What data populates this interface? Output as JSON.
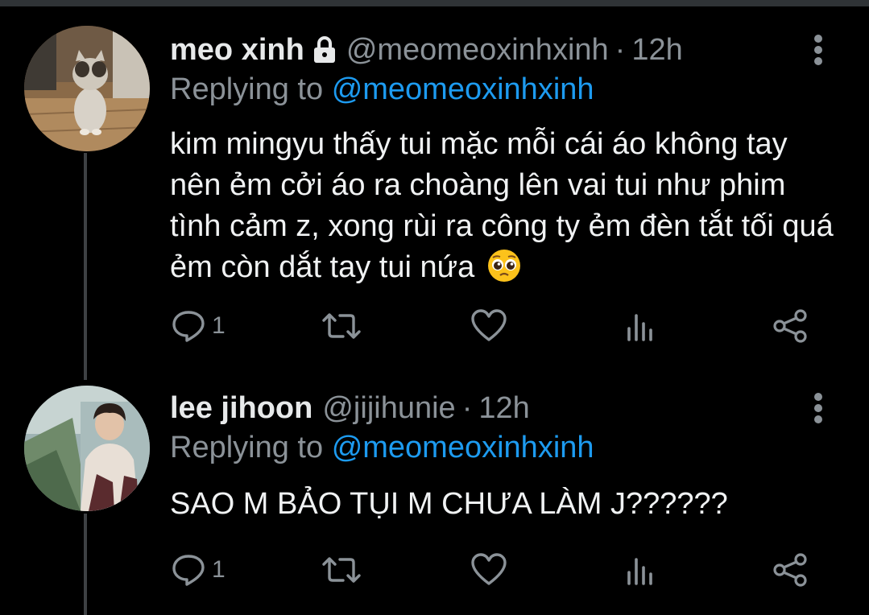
{
  "colors": {
    "background": "#000000",
    "text": "#e7e9ea",
    "muted": "#8b9298",
    "link": "#1d9bf0",
    "thread_line": "#3e4144"
  },
  "tweets": [
    {
      "display_name": "meo xinh",
      "protected": true,
      "protected_icon": "lock-icon",
      "handle": "@meomeoxinhxinh",
      "separator": "·",
      "time": "12h",
      "replying_prefix": "Replying to",
      "replying_to": "@meomeoxinhxinh",
      "text": "kim mingyu thấy tui mặc mỗi cái áo không tay nên ẻm cởi áo ra choàng lên vai tui như phim tình cảm z, xong rùi ra công ty ẻm đèn tắt tối quá ẻm còn dắt tay tui nứa",
      "emoji": "pleading-face-emoji",
      "reply_count": "1",
      "avatar": "kitten-standing-avatar"
    },
    {
      "display_name": "lee jihoon",
      "protected": false,
      "handle": "@jijihunie",
      "separator": "·",
      "time": "12h",
      "replying_prefix": "Replying to",
      "replying_to": "@meomeoxinhxinh",
      "text": "SAO M BẢO TỤI M CHƯA LÀM J??????",
      "reply_count": "1",
      "avatar": "young-man-seaside-avatar"
    }
  ],
  "action_icons": [
    "reply-icon",
    "retweet-icon",
    "like-icon",
    "analytics-icon",
    "share-icon"
  ],
  "menu_icon": "more-vertical-icon"
}
